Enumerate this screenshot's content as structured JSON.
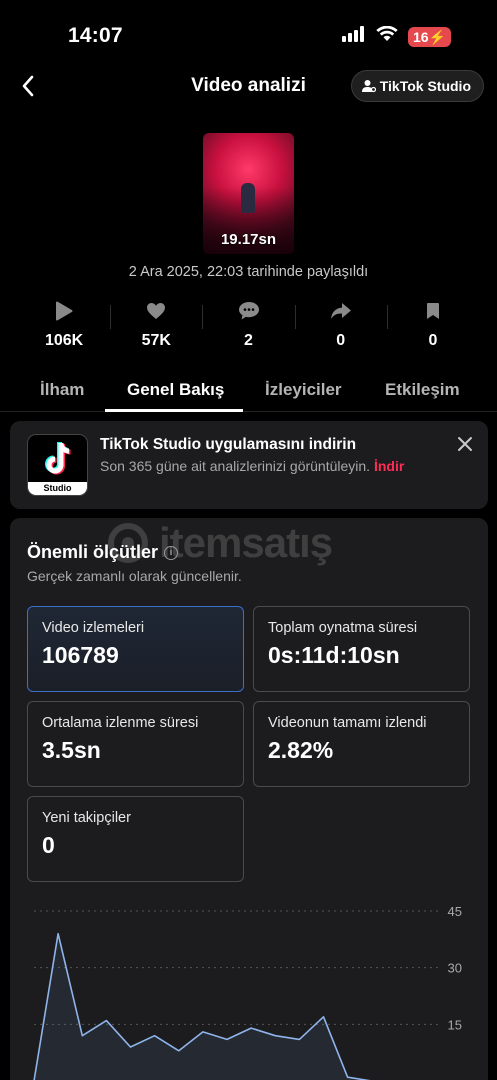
{
  "status_bar": {
    "time": "14:07",
    "battery": "16"
  },
  "nav": {
    "title": "Video analizi",
    "studio_button": "TikTok Studio"
  },
  "video": {
    "duration": "19.17sn",
    "shared": "2 Ara 2025, 22:03 tarihinde paylaşıldı"
  },
  "stats": [
    {
      "icon": "play-icon",
      "value": "106K"
    },
    {
      "icon": "heart-icon",
      "value": "57K"
    },
    {
      "icon": "comment-icon",
      "value": "2"
    },
    {
      "icon": "share-icon",
      "value": "0"
    },
    {
      "icon": "bookmark-icon",
      "value": "0"
    }
  ],
  "tabs": [
    "İlham",
    "Genel Bakış",
    "İzleyiciler",
    "Etkileşim"
  ],
  "active_tab": "Genel Bakış",
  "banner": {
    "title": "TikTok Studio uygulamasını indirin",
    "subtitle": "Son 365 güne ait analizlerinizi görüntüleyin.",
    "link": "İndir",
    "logo_label": "Studio"
  },
  "watermark": "itemsatış",
  "metrics_section": {
    "title": "Önemli ölçütler",
    "subtitle": "Gerçek zamanlı olarak güncellenir.",
    "items": [
      {
        "label": "Video izlemeleri",
        "value": "106789",
        "selected": true
      },
      {
        "label": "Toplam oynatma süresi",
        "value": "0s:11d:10sn"
      },
      {
        "label": "Ortalama izlenme süresi",
        "value": "3.5sn"
      },
      {
        "label": "Videonun tamamı izlendi",
        "value": "2.82%"
      },
      {
        "label": "Yeni takipçiler",
        "value": "0"
      }
    ]
  },
  "colors": {
    "accent": "#fe2c55",
    "selected_border": "#3b6fc9",
    "chart_line": "#8fb4ea"
  },
  "chart_data": {
    "type": "area",
    "y_ticks": [
      "45",
      "30",
      "15"
    ],
    "ylim": [
      0,
      45
    ],
    "values": [
      0,
      39,
      12,
      16,
      9,
      12,
      8,
      13,
      11,
      14,
      12,
      11,
      17,
      1,
      0,
      0,
      0
    ],
    "grid": true
  }
}
